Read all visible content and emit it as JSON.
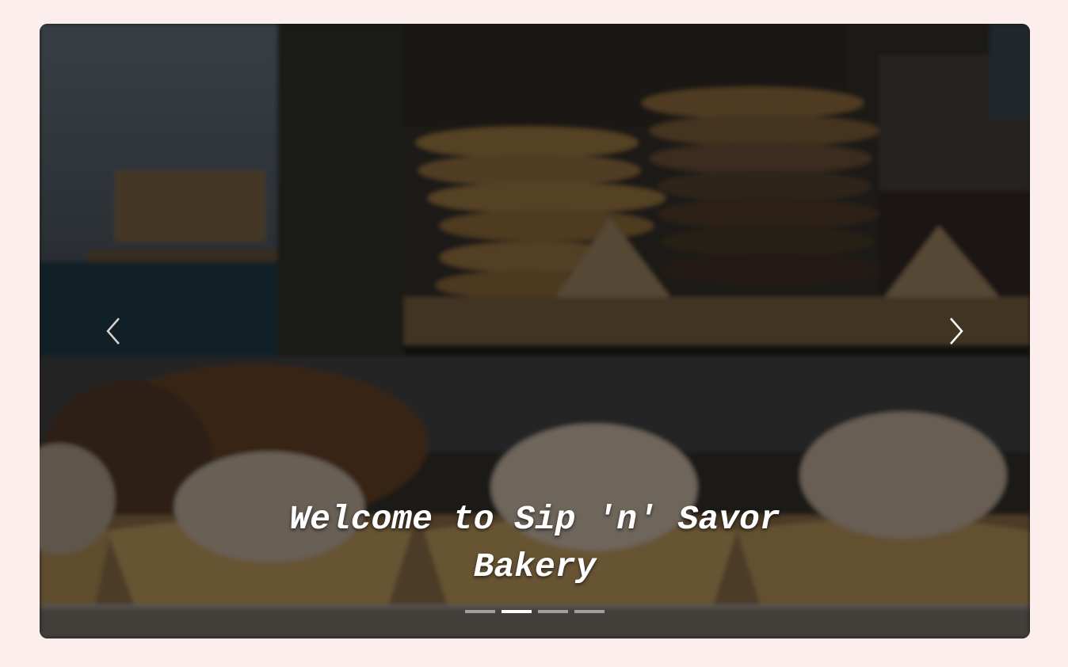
{
  "carousel": {
    "caption": "Welcome to Sip 'n' Savor Bakery",
    "prev_icon": "chevron-left-icon",
    "next_icon": "chevron-right-icon",
    "slide_count": 4,
    "active_slide": 2
  },
  "colors": {
    "page_background": "#fdeeee",
    "caption_text": "#ffffff",
    "indicator": "#ffffff"
  }
}
